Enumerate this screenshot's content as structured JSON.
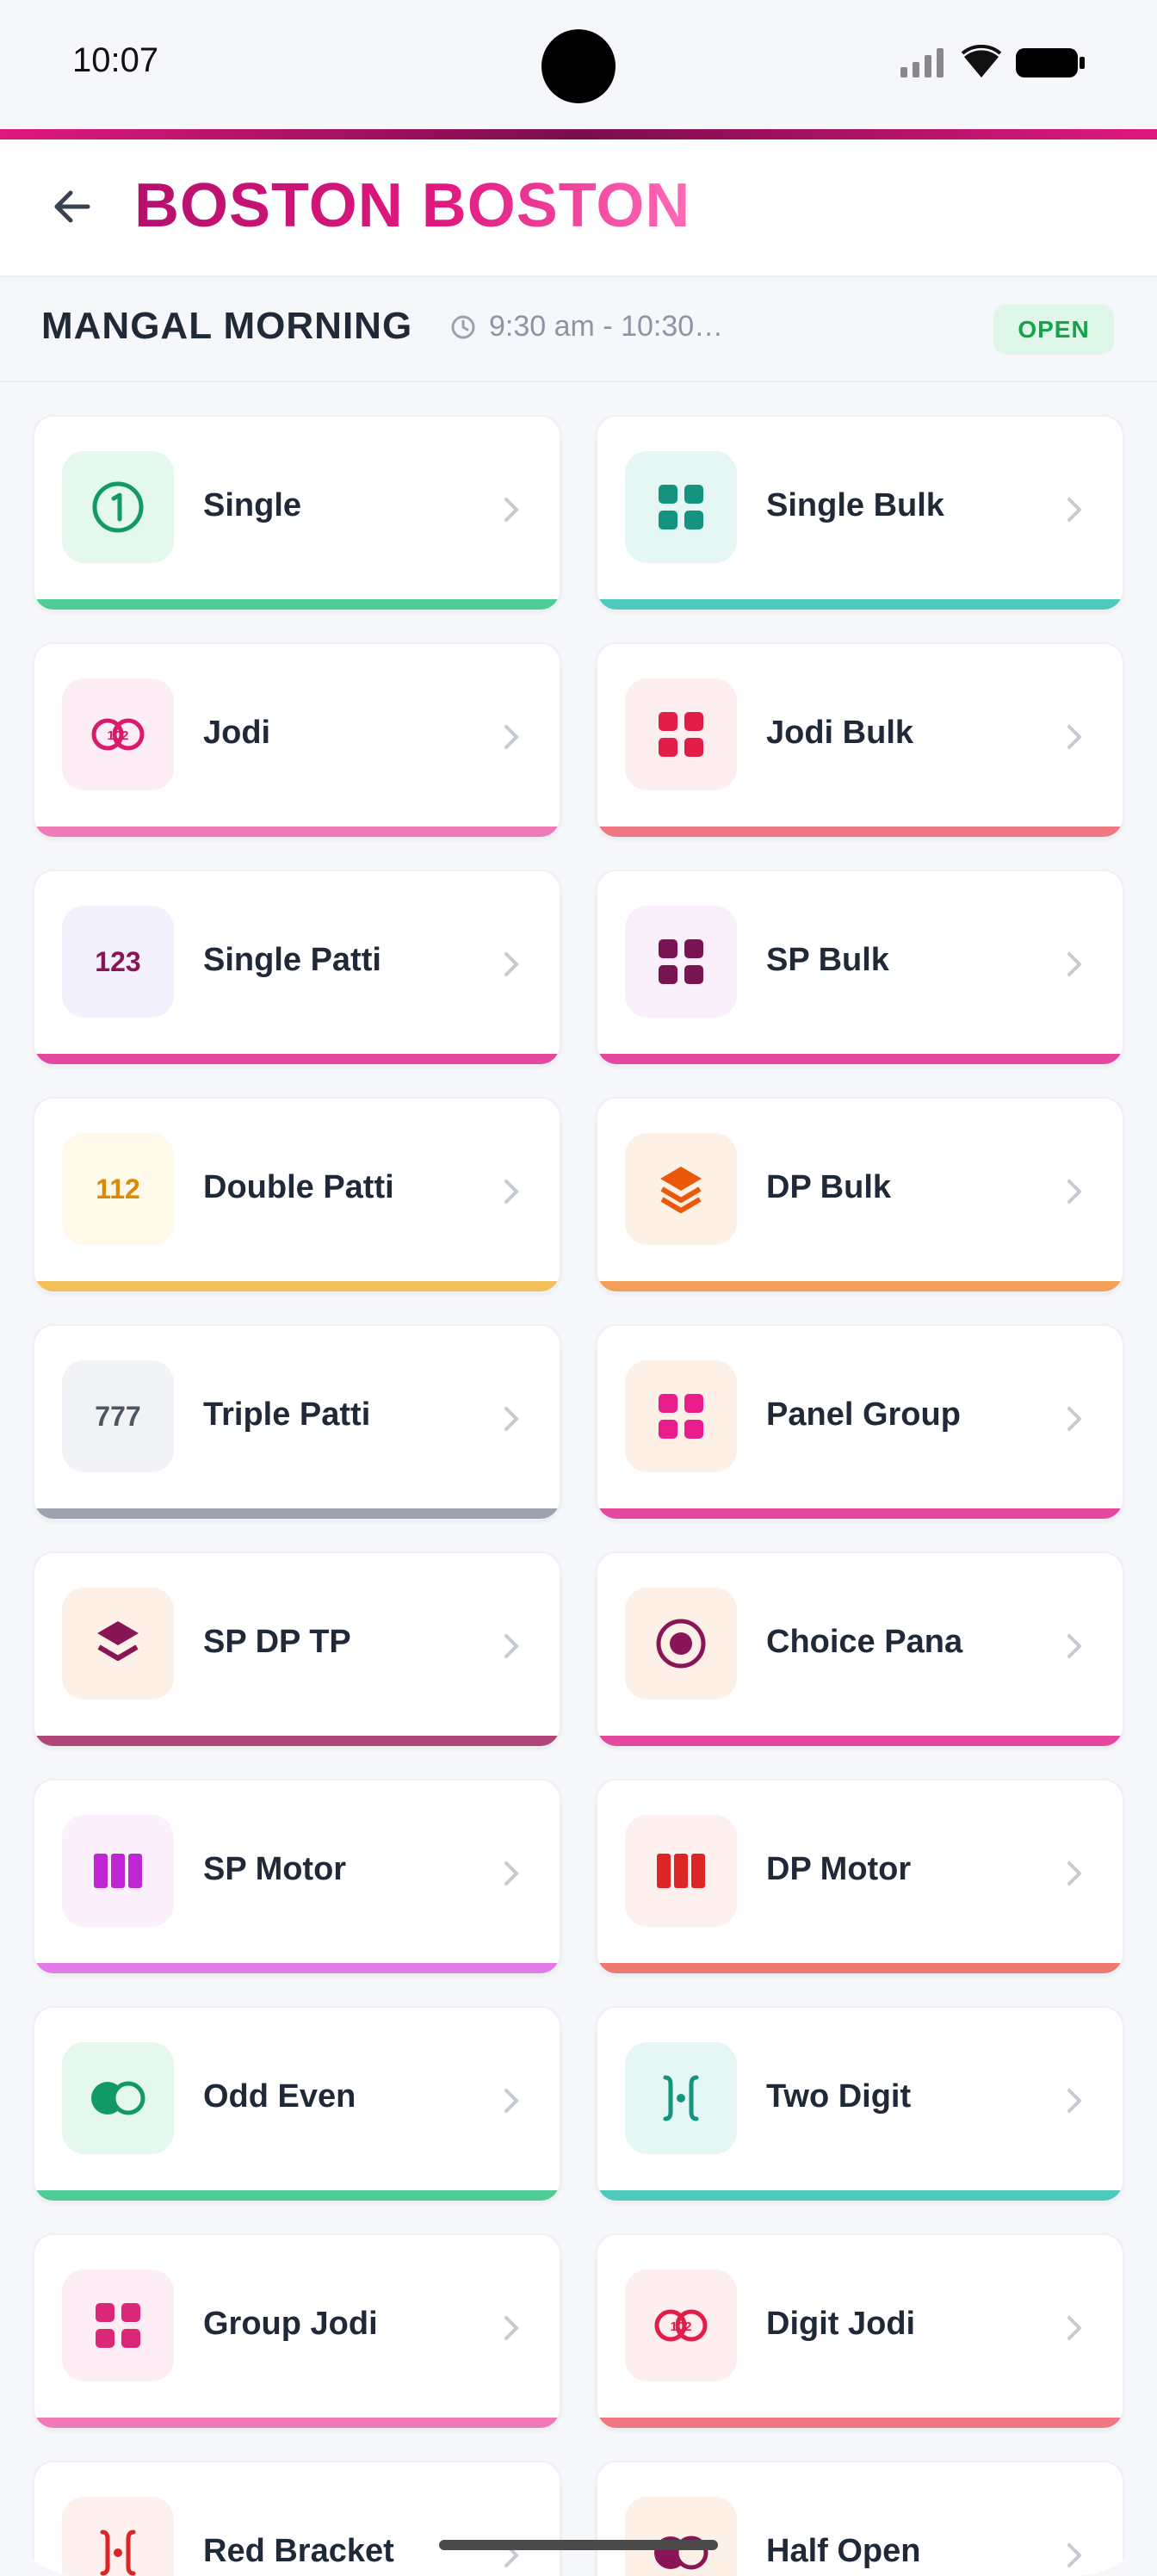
{
  "status": {
    "time": "10:07"
  },
  "header": {
    "title": "BOSTON BOSTON"
  },
  "session": {
    "name": "MANGAL MORNING",
    "time": "9:30 am - 10:30…",
    "badge": "OPEN"
  },
  "colors": {
    "green": "#4fcc96",
    "teal": "#4fc9bb",
    "pink": "#f07ab7",
    "rose": "#f07882",
    "magenta": "#e6479e",
    "orange": "#f5a05a",
    "yellow": "#f2c05a",
    "gray": "#9ca3af",
    "plum": "#b0467a",
    "violet": "#e17be6",
    "coral": "#ec7a6e"
  },
  "cards": [
    {
      "label": "Single",
      "icon": "number-one-icon"
    },
    {
      "label": "Single Bulk",
      "icon": "grid-icon"
    },
    {
      "label": "Jodi",
      "icon": "jodi-rings-icon"
    },
    {
      "label": "Jodi Bulk",
      "icon": "grid-icon"
    },
    {
      "label": "Single Patti",
      "icon": "number-123-icon",
      "icon_text": "123"
    },
    {
      "label": "SP Bulk",
      "icon": "grid-icon"
    },
    {
      "label": "Double Patti",
      "icon": "number-112-icon",
      "icon_text": "112"
    },
    {
      "label": "DP Bulk",
      "icon": "layers-icon"
    },
    {
      "label": "Triple Patti",
      "icon": "number-777-icon",
      "icon_text": "777"
    },
    {
      "label": "Panel Group",
      "icon": "grid-icon"
    },
    {
      "label": "SP DP TP",
      "icon": "layers-icon"
    },
    {
      "label": "Choice Pana",
      "icon": "target-icon"
    },
    {
      "label": "SP Motor",
      "icon": "motor-bars-icon"
    },
    {
      "label": "DP Motor",
      "icon": "motor-bars-icon"
    },
    {
      "label": "Odd Even",
      "icon": "odd-even-icon"
    },
    {
      "label": "Two Digit",
      "icon": "bracket-icon"
    },
    {
      "label": "Group Jodi",
      "icon": "grid-icon"
    },
    {
      "label": "Digit Jodi",
      "icon": "jodi-rings-icon"
    },
    {
      "label": "Red Bracket",
      "icon": "bracket-icon"
    },
    {
      "label": "Half Open",
      "icon": "odd-even-icon"
    }
  ]
}
